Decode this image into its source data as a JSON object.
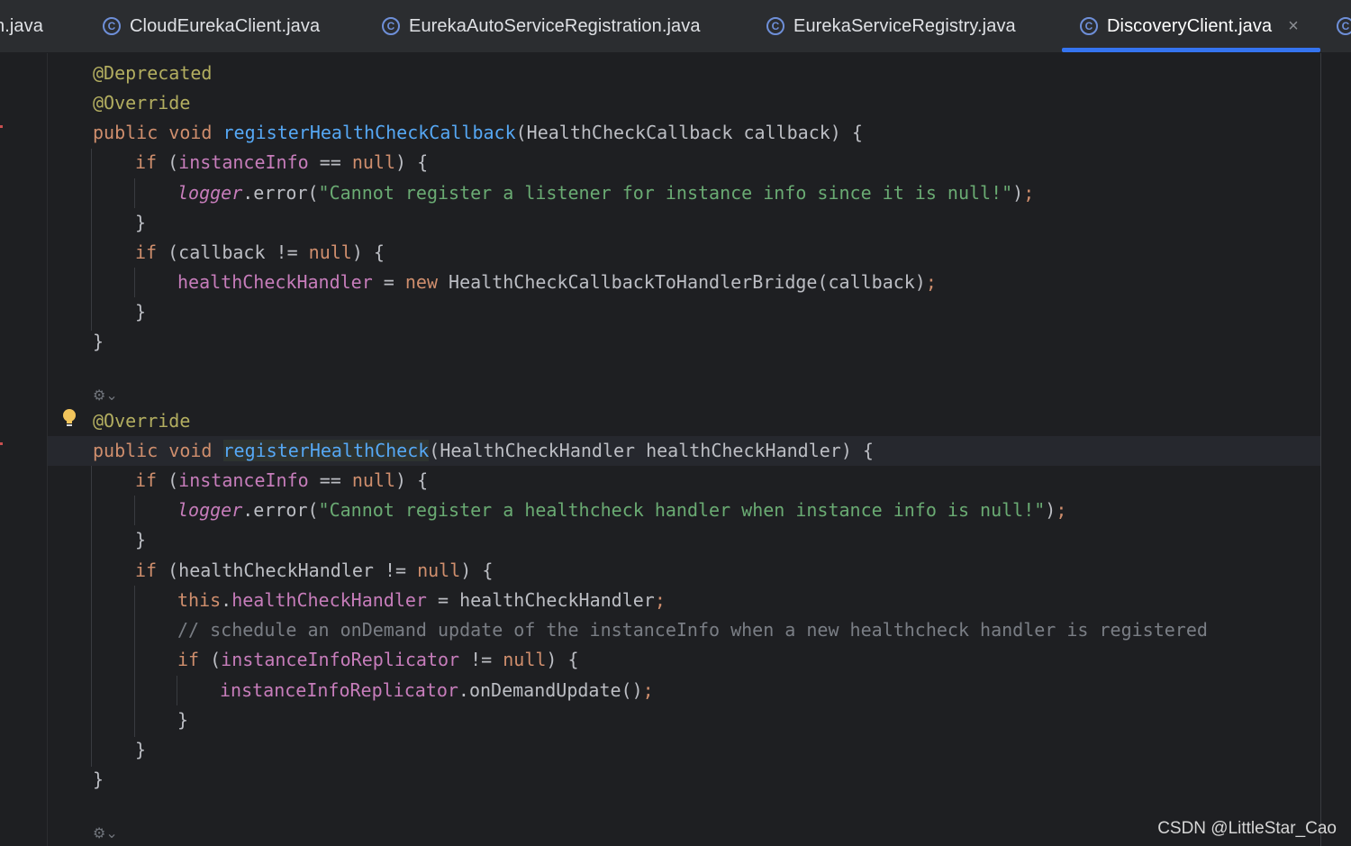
{
  "tabs": [
    {
      "label": "n.java",
      "icon": "class-icon",
      "active": false
    },
    {
      "label": "CloudEurekaClient.java",
      "icon": "class-icon",
      "active": false
    },
    {
      "label": "EurekaAutoServiceRegistration.java",
      "icon": "class-icon",
      "active": false
    },
    {
      "label": "EurekaServiceRegistry.java",
      "icon": "class-icon",
      "active": false
    },
    {
      "label": "DiscoveryClient.java",
      "icon": "class-icon",
      "active": true
    }
  ],
  "close_glyph": "×",
  "class_glyph": "C",
  "code": {
    "l1": "@Deprecated",
    "l2": "@Override",
    "l3_a": "public void ",
    "l3_fn": "registerHealthCheckCallback",
    "l3_b": "(HealthCheckCallback callback) {",
    "l4_a": "if ",
    "l4_b": "(",
    "l4_field": "instanceInfo",
    "l4_c": " == ",
    "l4_null": "null",
    "l4_d": ") {",
    "l5_logger": "logger",
    "l5_a": ".error(",
    "l5_str": "\"Cannot register a listener for instance info since it is null!\"",
    "l5_b": ")",
    "l5_semi": ";",
    "l6": "}",
    "l7_a": "if ",
    "l7_b": "(callback != ",
    "l7_null": "null",
    "l7_c": ") {",
    "l8_field": "healthCheckHandler",
    "l8_a": " = ",
    "l8_new": "new ",
    "l8_b": "HealthCheckCallbackToHandlerBridge(callback)",
    "l8_semi": ";",
    "l9": "}",
    "l10": "}",
    "l11": "@Override",
    "l12_a": "public void ",
    "l12_fn": "registerHealthCheck",
    "l12_b": "(HealthCheckHandler healthCheckHandler) {",
    "l13_a": "if ",
    "l13_b": "(",
    "l13_field": "instanceInfo",
    "l13_c": " == ",
    "l13_null": "null",
    "l13_d": ") {",
    "l14_logger": "logger",
    "l14_a": ".error(",
    "l14_str": "\"Cannot register a healthcheck handler when instance info is null!\"",
    "l14_b": ")",
    "l14_semi": ";",
    "l15": "}",
    "l16_a": "if ",
    "l16_b": "(healthCheckHandler != ",
    "l16_null": "null",
    "l16_c": ") {",
    "l17_this": "this",
    "l17_a": ".",
    "l17_field": "healthCheckHandler",
    "l17_b": " = healthCheckHandler",
    "l17_semi": ";",
    "l18": "// schedule an onDemand update of the instanceInfo when a new healthcheck handler is registered",
    "l19_a": "if ",
    "l19_b": "(",
    "l19_field": "instanceInfoReplicator",
    "l19_c": " != ",
    "l19_null": "null",
    "l19_d": ") {",
    "l20_field": "instanceInfoReplicator",
    "l20_a": ".onDemandUpdate()",
    "l20_semi": ";",
    "l21": "}",
    "l22": "}",
    "l23": "}"
  },
  "fold_glyph": "⚙⌄",
  "watermark": "CSDN @LittleStar_Cao",
  "colors": {
    "background": "#1e1f22",
    "keyword": "#cf8e6d",
    "annotation": "#b3ae60",
    "method": "#56a8f5",
    "field": "#c77dbb",
    "string": "#6aab73",
    "comment": "#7a7e85",
    "active_tab_underline": "#3574f0"
  }
}
